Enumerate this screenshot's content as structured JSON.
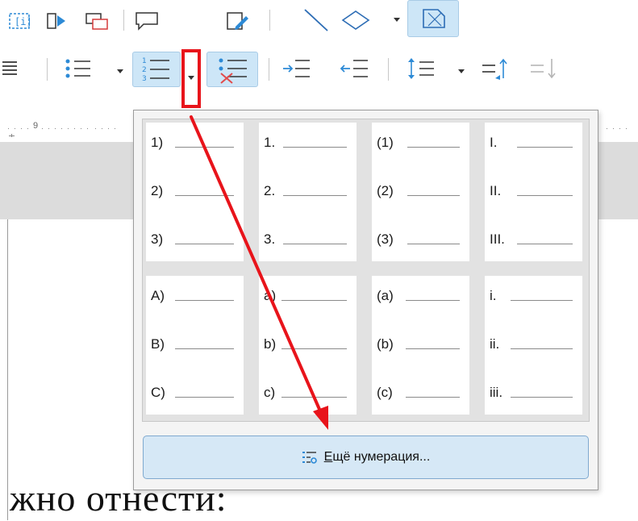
{
  "ruler": {
    "tick_label": "9"
  },
  "list_menu": {
    "numbering_presets": [
      [
        "1)",
        "2)",
        "3)"
      ],
      [
        "1.",
        "2.",
        "3."
      ],
      [
        "(1)",
        "(2)",
        "(3)"
      ],
      [
        "I.",
        "II.",
        "III."
      ],
      [
        "A)",
        "B)",
        "C)"
      ],
      [
        "a)",
        "b)",
        "c)"
      ],
      [
        "(a)",
        "(b)",
        "(c)"
      ],
      [
        "i.",
        "ii.",
        "iii."
      ]
    ],
    "more_numbering": {
      "mnemonic": "Е",
      "rest": "щё нумерация..."
    }
  },
  "document": {
    "visible_text": "жно отнести:"
  },
  "colors": {
    "annotation_red": "#e8141b",
    "selected_blue": "#cde6f7",
    "button_blue": "#d6e8f6"
  },
  "icons": [
    "insert-field-icon",
    "slide-show-icon",
    "insert-frame-icon",
    "comment-icon",
    "edit-icon",
    "line-icon",
    "shape-icon",
    "eraser-shape-icon",
    "align-justify-icon",
    "bullets-icon",
    "numbering-icon",
    "no-list-icon",
    "increase-indent-icon",
    "decrease-indent-icon",
    "line-spacing-icon",
    "paragraph-spacing-increase-icon",
    "paragraph-spacing-decrease-icon"
  ]
}
